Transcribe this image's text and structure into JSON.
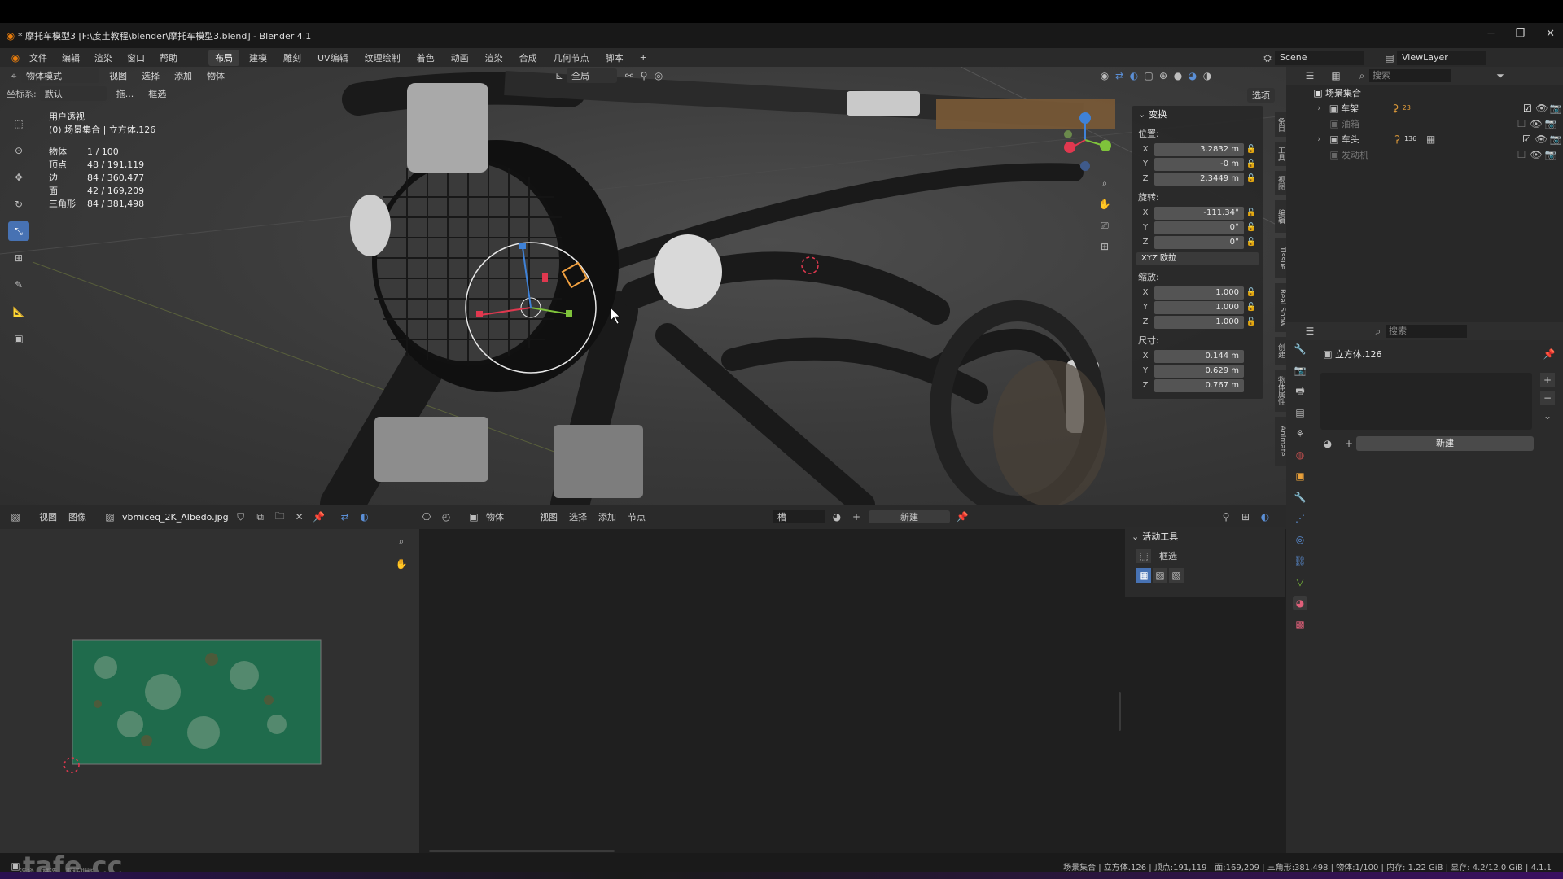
{
  "window": {
    "title": "* 摩托车模型3 [F:\\度土教程\\blender\\摩托车模型3.blend] - Blender 4.1"
  },
  "menubar": {
    "menus": [
      "文件",
      "编辑",
      "渲染",
      "窗口",
      "帮助"
    ],
    "workspaces": [
      "布局",
      "建模",
      "雕刻",
      "UV编辑",
      "纹理绘制",
      "着色",
      "动画",
      "渲染",
      "合成",
      "几何节点",
      "脚本"
    ],
    "active_workspace": "布局",
    "add_tab": "+",
    "scene": "Scene",
    "view_layer": "ViewLayer"
  },
  "viewport": {
    "mode": "物体模式",
    "menus": [
      "视图",
      "选择",
      "添加",
      "物体"
    ],
    "transform_orientation": "全局",
    "coord_label": "坐标系:",
    "coord_value": "默认",
    "drag_label": "拖...",
    "select_mode": "框选",
    "options": "选项",
    "view_name": "用户透视",
    "collection_line": "(0) 场景集合 | 立方体.126",
    "stats": [
      {
        "label": "物体",
        "value": "1 / 100"
      },
      {
        "label": "顶点",
        "value": "48 / 191,119"
      },
      {
        "label": "边",
        "value": "84 / 360,477"
      },
      {
        "label": "面",
        "value": "42 / 169,209"
      },
      {
        "label": "三角形",
        "value": "84 / 381,498"
      }
    ]
  },
  "transform_panel": {
    "title": "变换",
    "location_label": "位置:",
    "location": [
      {
        "k": "X",
        "v": "3.2832 m"
      },
      {
        "k": "Y",
        "v": "-0 m"
      },
      {
        "k": "Z",
        "v": "2.3449 m"
      }
    ],
    "rotation_label": "旋转:",
    "rotation": [
      {
        "k": "X",
        "v": "-111.34°"
      },
      {
        "k": "Y",
        "v": "0°"
      },
      {
        "k": "Z",
        "v": "0°"
      }
    ],
    "rotation_mode": "XYZ 欧拉",
    "scale_label": "缩放:",
    "scale": [
      {
        "k": "X",
        "v": "1.000"
      },
      {
        "k": "Y",
        "v": "1.000"
      },
      {
        "k": "Z",
        "v": "1.000"
      }
    ],
    "dimensions_label": "尺寸:",
    "dimensions": [
      {
        "k": "X",
        "v": "0.144 m"
      },
      {
        "k": "Y",
        "v": "0.629 m"
      },
      {
        "k": "Z",
        "v": "0.767 m"
      }
    ]
  },
  "side_tabs": [
    "条目",
    "工具",
    "视图",
    "编辑",
    "Tissue",
    "Real Snow",
    "创建",
    "物体属性",
    "Animate"
  ],
  "outliner": {
    "search_placeholder": "搜索",
    "root": "场景集合",
    "items": [
      {
        "name": "车架",
        "badge": "23",
        "enabled": true
      },
      {
        "name": "油箱",
        "badge": "",
        "enabled": false
      },
      {
        "name": "车头",
        "badge": "136",
        "enabled": true
      },
      {
        "name": "发动机",
        "badge": "",
        "enabled": false
      }
    ]
  },
  "properties": {
    "search_placeholder": "搜索",
    "object_name": "立方体.126",
    "new_label": "新建"
  },
  "image_editor": {
    "menus": [
      "视图",
      "图像"
    ],
    "image_name": "vbmiceq_2K_Albedo.jpg"
  },
  "node_editor": {
    "object_label": "物体",
    "menus": [
      "视图",
      "选择",
      "添加",
      "节点"
    ],
    "slot_label": "槽",
    "new_label": "新建"
  },
  "tool_panel": {
    "title": "活动工具",
    "tool": "框选"
  },
  "statusbar": {
    "left_labels": [
      "选择",
      "框选",
      "平移视图"
    ],
    "info": "场景集合 | 立方体.126 | 顶点:191,119 | 面:169,209 | 三角形:381,498 | 物体:1/100 | 内存: 1.22 GiB | 显存: 4.2/12.0 GiB | 4.1.1"
  },
  "watermark": "tafe.cc",
  "colors": {
    "accent": "#4772b3",
    "x_axis": "#e0384f",
    "y_axis": "#7fc33b",
    "z_axis": "#3f82d8",
    "texture_green": "#1f6b4c"
  }
}
